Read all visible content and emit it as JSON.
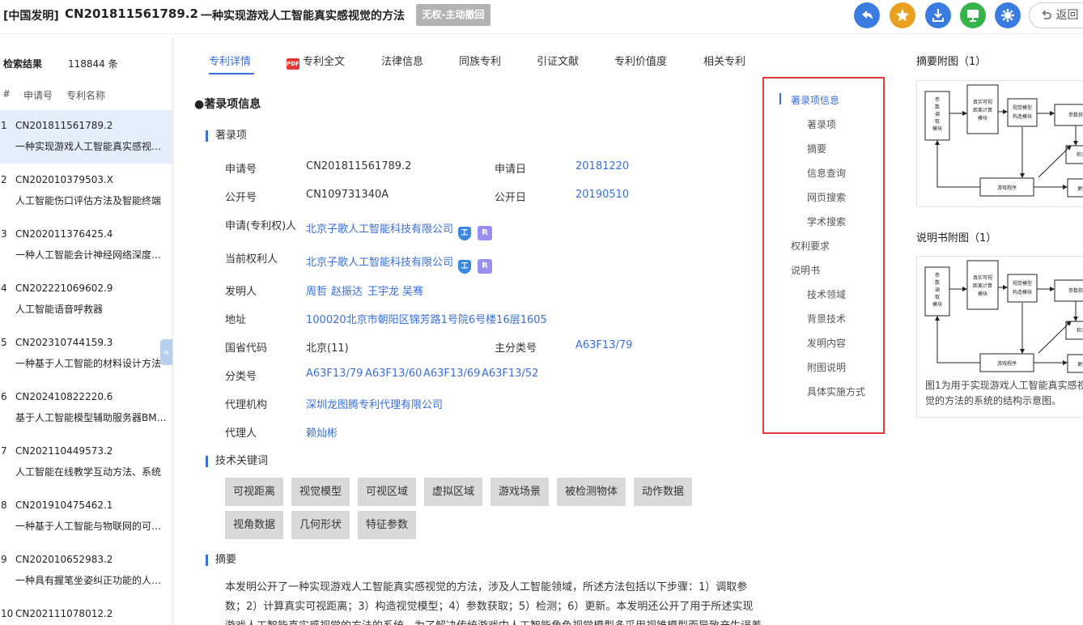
{
  "header": {
    "type_label": "[中国发明]",
    "patent_number": "CN201811561789.2",
    "title": "一种实现游戏人工智能真实感视觉的方法",
    "status_badge": "无权-主动撤回",
    "back_label": "返回",
    "action_colors": [
      "#3a7be0",
      "#e8a020",
      "#3a7be0",
      "#36b34a",
      "#3a7be0"
    ]
  },
  "sidebar": {
    "result_label": "检索结果",
    "result_count": "118844 条",
    "col_index": "#",
    "col_number": "申请号",
    "col_name": "专利名称",
    "items": [
      {
        "idx": "1",
        "number": "CN201811561789.2",
        "name": "一种实现游戏人工智能真实感视觉的方法"
      },
      {
        "idx": "2",
        "number": "CN202010379503.X",
        "name": "人工智能伤口评估方法及智能终端"
      },
      {
        "idx": "3",
        "number": "CN202011376425.4",
        "name": "一种人工智能会计神经网络深度学习系统"
      },
      {
        "idx": "4",
        "number": "CN202221069602.9",
        "name": "人工智能语音呼救器"
      },
      {
        "idx": "5",
        "number": "CN202310744159.3",
        "name": "一种基于人工智能的材料设计方法"
      },
      {
        "idx": "6",
        "number": "CN202410822220.6",
        "name": "基于人工智能模型辅助服务器BMC的方法"
      },
      {
        "idx": "7",
        "number": "CN202110449573.2",
        "name": "人工智能在线教学互动方法、系统"
      },
      {
        "idx": "8",
        "number": "CN201910475462.1",
        "name": "一种基于人工智能与物联网的可视化系统"
      },
      {
        "idx": "9",
        "number": "CN202010652983.2",
        "name": "一种具有握笔坐姿纠正功能的人工智能台灯"
      },
      {
        "idx": "10",
        "number": "CN202111078012.2",
        "name": ""
      }
    ],
    "collapse_glyph": "«"
  },
  "tabs": [
    "专利详情",
    "专利全文",
    "法律信息",
    "同族专利",
    "引证文献",
    "专利价值度",
    "相关专利"
  ],
  "pdf_icon_text": "PDF",
  "main": {
    "section_title": "●著录项信息",
    "biblio_subtitle": "著录项",
    "fields": {
      "app_no_label": "申请号",
      "app_no": "CN201811561789.2",
      "app_date_label": "申请日",
      "app_date": "20181220",
      "pub_no_label": "公开号",
      "pub_no": "CN109731340A",
      "pub_date_label": "公开日",
      "pub_date": "20190510",
      "applicant_label": "申请(专利权)人",
      "applicant": "北京子歌人工智能科技有限公司",
      "owner_label": "当前权利人",
      "owner": "北京子歌人工智能科技有限公司",
      "inventor_label": "发明人",
      "inventors": [
        "周哲",
        "赵振达",
        "王宇龙",
        "吴骞"
      ],
      "address_label": "地址",
      "address": "100020北京市朝阳区锦芳路1号院6号楼16层1605",
      "region_label": "国省代码",
      "region": "北京(11)",
      "main_class_label": "主分类号",
      "main_class": "A63F13/79",
      "classes_label": "分类号",
      "classes": [
        "A63F13/79",
        "A63F13/60",
        "A63F13/69",
        "A63F13/52"
      ],
      "agency_label": "代理机构",
      "agency": "深圳龙图腾专利代理有限公司",
      "agent_label": "代理人",
      "agent": "赖灿彬",
      "badge_i": "工",
      "badge_r": "R"
    },
    "keywords_subtitle": "技术关键词",
    "keywords": [
      "可视距离",
      "视觉模型",
      "可视区域",
      "虚拟区域",
      "游戏场景",
      "被检测物体",
      "动作数据",
      "视角数据",
      "几何形状",
      "特征参数"
    ],
    "abstract_subtitle": "摘要",
    "abstract": "本发明公开了一种实现游戏人工智能真实感视觉的方法，涉及人工智能领域，所述方法包括以下步骤：1）调取参数；2）计算真实可视距离；3）构造视觉模型；4）参数获取；5）检测；6）更新。本发明还公开了用于所述实现游戏人工智能真实感视觉的方法的系统，为了解决传统游戏中人工智能角色视觉模型多采用视锥模型而导致产生误差并"
  },
  "toc": {
    "items": [
      "著录项信息",
      "著录项",
      "摘要",
      "信息查询",
      "网页搜索",
      "学术搜索",
      "权利要求",
      "说明书",
      "技术领域",
      "背景技术",
      "发明内容",
      "附图说明",
      "具体实施方式"
    ]
  },
  "right": {
    "abstract_fig_title": "摘要附图（1）",
    "spec_fig_title": "说明书附图（1）",
    "caption": "图1为用于实现游戏人工智能真实感视觉的方法的系统的结构示意图。",
    "diagram": {
      "box1": [
        "参",
        "数",
        "调",
        "取",
        "模块"
      ],
      "box2": [
        "真实可视",
        "距离计算",
        "模块"
      ],
      "box3": [
        "视觉模型",
        "构造模块"
      ],
      "box4": "参数获",
      "box5": "检测",
      "box6": "游戏程序",
      "box7": "更新"
    }
  }
}
